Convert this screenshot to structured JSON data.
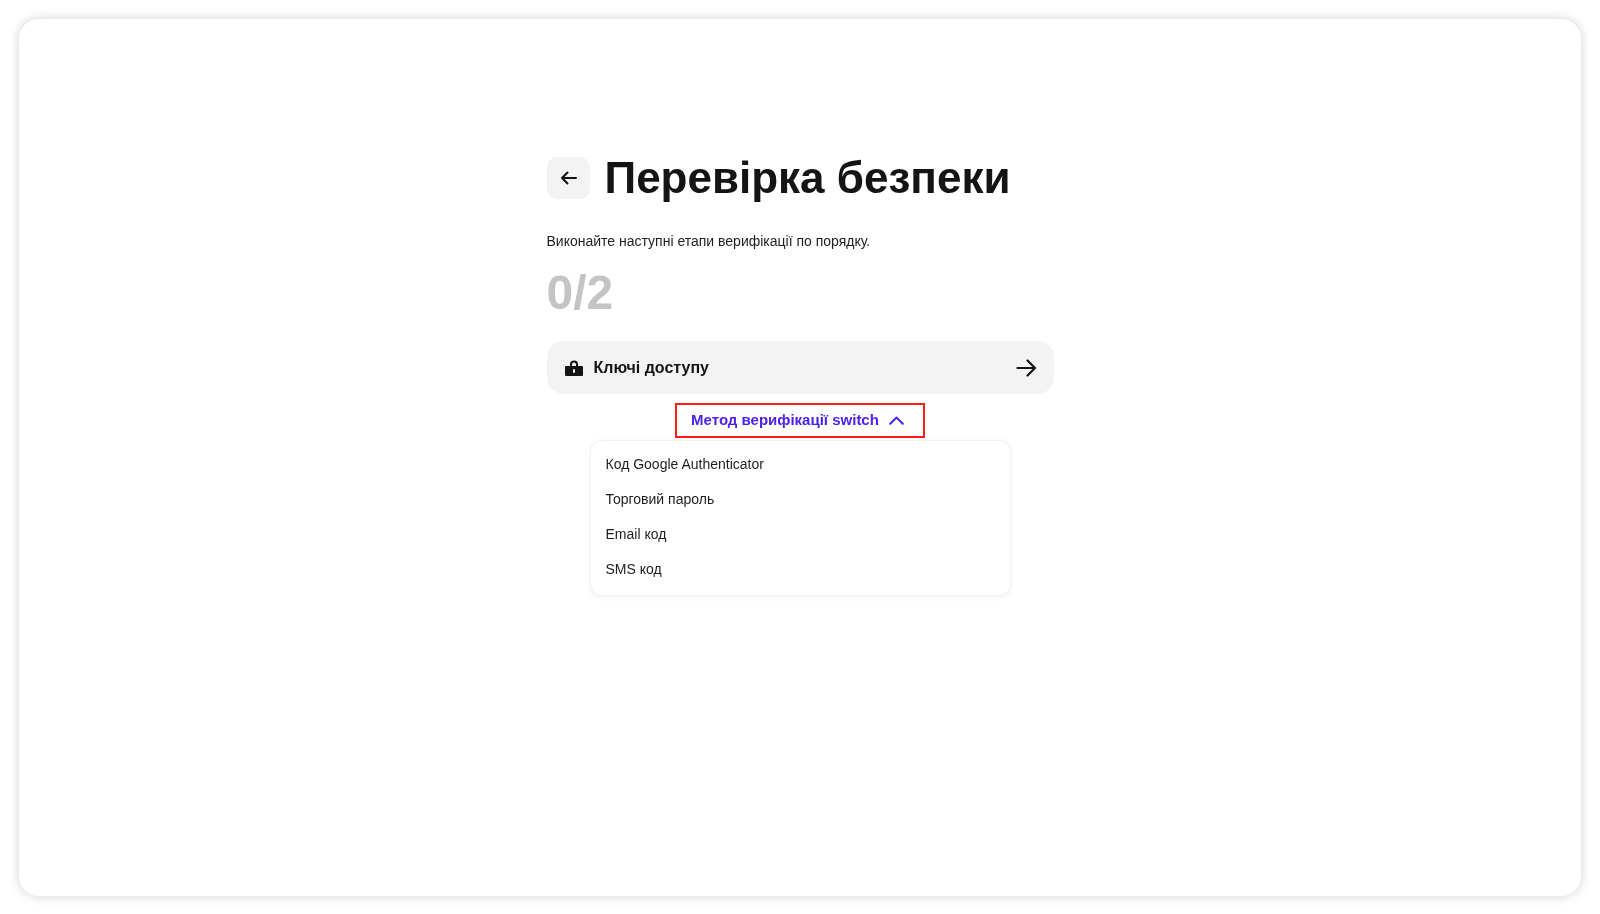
{
  "header": {
    "title": "Перевірка безпеки"
  },
  "subtitle": "Виконайте наступні етапи верифікації по порядку.",
  "progress": "0/2",
  "steps": [
    {
      "label": "Ключі доступу"
    }
  ],
  "method_switch": {
    "label": "Метод верифікації switch",
    "expanded": true,
    "highlighted": true
  },
  "method_menu": {
    "items": [
      {
        "label": "Код Google Authenticator"
      },
      {
        "label": "Торговий пароль"
      },
      {
        "label": "Email код"
      },
      {
        "label": "SMS код"
      }
    ]
  }
}
